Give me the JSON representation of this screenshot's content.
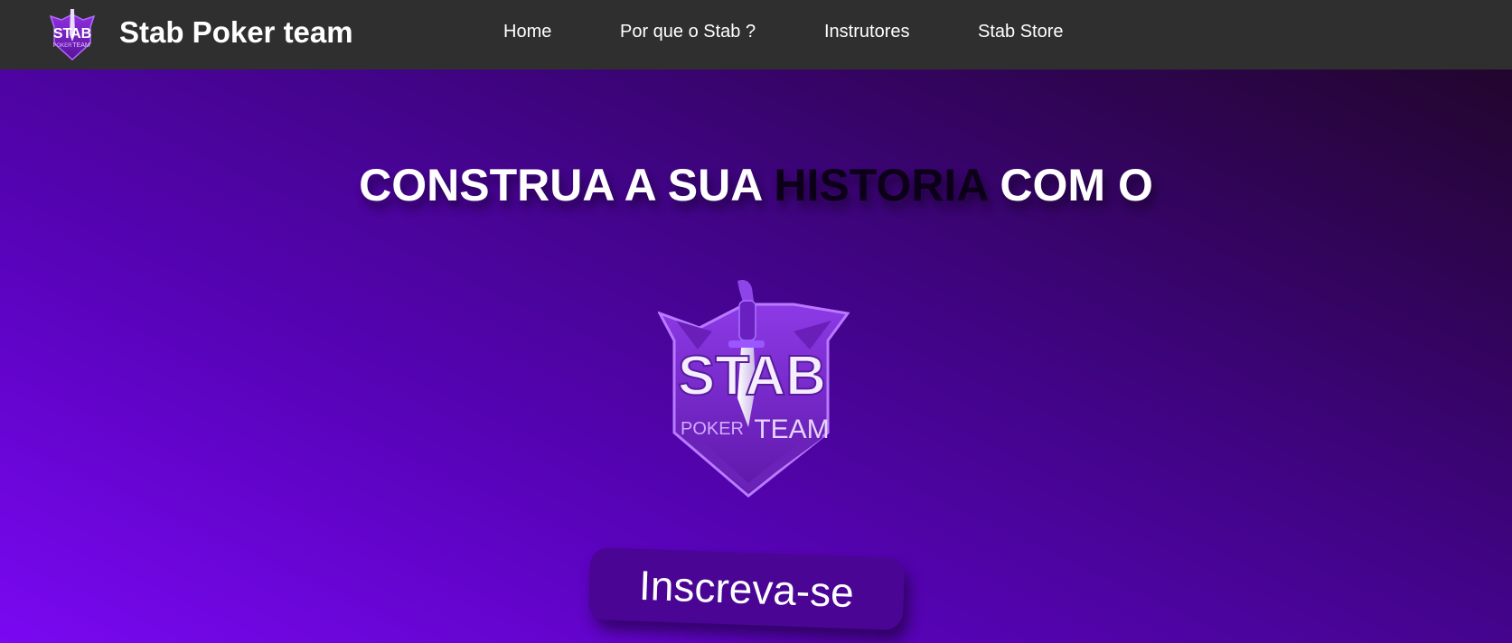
{
  "header": {
    "brand": "Stab Poker team",
    "logo_text": {
      "main": "STAB",
      "sub_left": "POKER",
      "sub_right": "TEAM"
    },
    "nav": [
      {
        "label": "Home"
      },
      {
        "label": "Por que o Stab ?"
      },
      {
        "label": "Instrutores"
      },
      {
        "label": "Stab Store"
      }
    ]
  },
  "hero": {
    "headline_part1": "CONSTRUA A SUA ",
    "headline_accent": "HISTORIA",
    "headline_part2": " COM O",
    "logo_text": {
      "main": "STAB",
      "sub_left": "POKER",
      "sub_right": "TEAM"
    },
    "cta_label": "Inscreva-se"
  },
  "colors": {
    "navbar_bg": "#2f2f2f",
    "hero_gradient_start": "#7a08f2",
    "hero_gradient_end": "#22052d",
    "cta_bg": "#4a0594",
    "accent_text": "#0c0018"
  },
  "icons": [
    "stab-logo-icon",
    "dagger-icon"
  ]
}
